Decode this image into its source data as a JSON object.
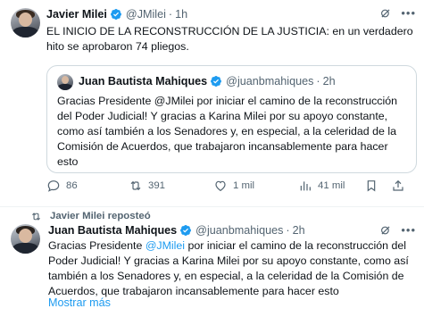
{
  "tweet1": {
    "author_name": "Javier Milei",
    "handle": "@JMilei",
    "separator": "·",
    "time": "1h",
    "text": "EL INICIO DE LA RECONSTRUCCIÓN DE LA JUSTICIA: en un verdadero hito se aprobaron 74 pliegos.",
    "quote": {
      "author_name": "Juan Bautista Mahiques",
      "handle": "@juanbmahiques",
      "separator": "·",
      "time": "2h",
      "text": "Gracias Presidente @JMilei por iniciar el camino de la reconstrucción del Poder Judicial! Y gracias a Karina Milei por su apoyo constante, como así también a los Senadores y, en especial, a la celeridad de la Comisión de Acuerdos, que trabajaron incansablemente para hacer esto"
    },
    "actions": {
      "replies": "86",
      "reposts": "391",
      "likes": "1 mil",
      "views": "41 mil"
    }
  },
  "tweet2": {
    "reposted_by": "Javier Milei reposteó",
    "author_name": "Juan Bautista Mahiques",
    "handle": "@juanbmahiques",
    "separator": "·",
    "time": "2h",
    "text_before": "Gracias Presidente ",
    "mention": "@JMilei",
    "text_after": " por iniciar el camino de la reconstrucción del Poder Judicial! Y gracias a Karina Milei por su apoyo constante, como así también a los Senadores y, en especial, a la celeridad de la Comisión de Acuerdos, que trabajaron incansablemente para hacer esto",
    "show_more": "Mostrar más"
  },
  "colors": {
    "verified": "#1d9bf0",
    "secondary_text": "#536471",
    "link": "#1d9bf0"
  }
}
